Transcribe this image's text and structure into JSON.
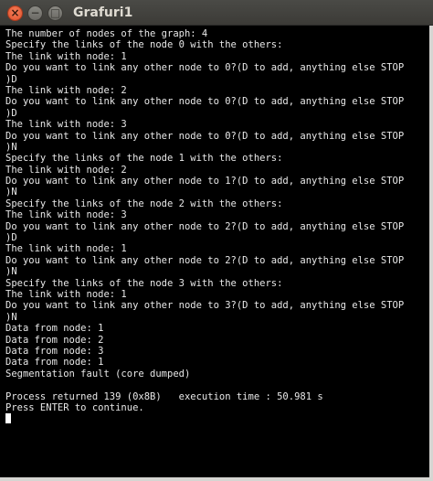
{
  "window": {
    "title": "Grafuri1",
    "close_glyph": "×",
    "minimize_glyph": "−",
    "maximize_glyph": "□"
  },
  "terminal": {
    "lines": [
      "The number of nodes of the graph: 4",
      "Specify the links of the node 0 with the others:",
      "The link with node: 1",
      "Do you want to link any other node to 0?(D to add, anything else STOP",
      ")D",
      "The link with node: 2",
      "Do you want to link any other node to 0?(D to add, anything else STOP",
      ")D",
      "The link with node: 3",
      "Do you want to link any other node to 0?(D to add, anything else STOP",
      ")N",
      "Specify the links of the node 1 with the others:",
      "The link with node: 2",
      "Do you want to link any other node to 1?(D to add, anything else STOP",
      ")N",
      "Specify the links of the node 2 with the others:",
      "The link with node: 3",
      "Do you want to link any other node to 2?(D to add, anything else STOP",
      ")D",
      "The link with node: 1",
      "Do you want to link any other node to 2?(D to add, anything else STOP",
      ")N",
      "Specify the links of the node 3 with the others:",
      "The link with node: 1",
      "Do you want to link any other node to 3?(D to add, anything else STOP",
      ")N",
      "Data from node: 1",
      "Data from node: 2",
      "Data from node: 3",
      "Data from node: 1",
      "Segmentation fault (core dumped)",
      "",
      "Process returned 139 (0x8B)   execution time : 50.981 s",
      "Press ENTER to continue."
    ]
  }
}
